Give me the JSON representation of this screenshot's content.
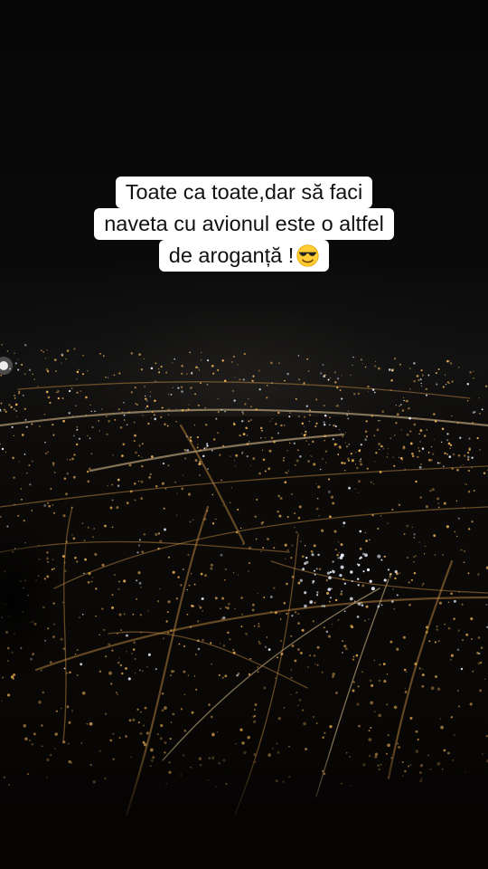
{
  "caption": {
    "line1": "Toate ca toate,dar să faci",
    "line2": "naveta cu avionul este o altfel",
    "line3": "de aroganță !",
    "emoji": "smiling-face-with-sunglasses-icon"
  },
  "colors": {
    "caption_bg": "#ffffff",
    "caption_text": "#111111",
    "city_lights": "#f2b65a",
    "city_lights_white": "#e8eefc",
    "night_sky": "#060606"
  }
}
